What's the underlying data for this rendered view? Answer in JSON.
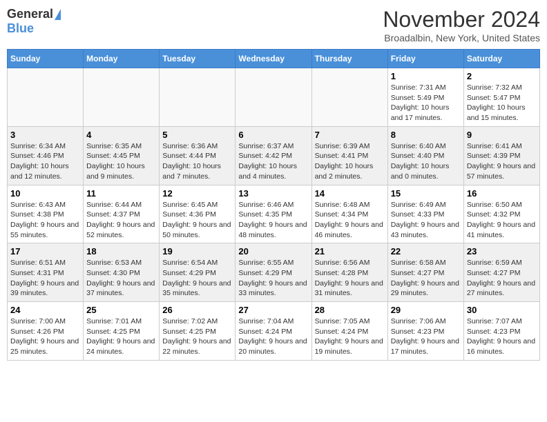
{
  "logo": {
    "general": "General",
    "blue": "Blue"
  },
  "title": "November 2024",
  "location": "Broadalbin, New York, United States",
  "headers": [
    "Sunday",
    "Monday",
    "Tuesday",
    "Wednesday",
    "Thursday",
    "Friday",
    "Saturday"
  ],
  "weeks": [
    [
      {
        "day": "",
        "info": ""
      },
      {
        "day": "",
        "info": ""
      },
      {
        "day": "",
        "info": ""
      },
      {
        "day": "",
        "info": ""
      },
      {
        "day": "",
        "info": ""
      },
      {
        "day": "1",
        "info": "Sunrise: 7:31 AM\nSunset: 5:49 PM\nDaylight: 10 hours and 17 minutes."
      },
      {
        "day": "2",
        "info": "Sunrise: 7:32 AM\nSunset: 5:47 PM\nDaylight: 10 hours and 15 minutes."
      }
    ],
    [
      {
        "day": "3",
        "info": "Sunrise: 6:34 AM\nSunset: 4:46 PM\nDaylight: 10 hours and 12 minutes."
      },
      {
        "day": "4",
        "info": "Sunrise: 6:35 AM\nSunset: 4:45 PM\nDaylight: 10 hours and 9 minutes."
      },
      {
        "day": "5",
        "info": "Sunrise: 6:36 AM\nSunset: 4:44 PM\nDaylight: 10 hours and 7 minutes."
      },
      {
        "day": "6",
        "info": "Sunrise: 6:37 AM\nSunset: 4:42 PM\nDaylight: 10 hours and 4 minutes."
      },
      {
        "day": "7",
        "info": "Sunrise: 6:39 AM\nSunset: 4:41 PM\nDaylight: 10 hours and 2 minutes."
      },
      {
        "day": "8",
        "info": "Sunrise: 6:40 AM\nSunset: 4:40 PM\nDaylight: 10 hours and 0 minutes."
      },
      {
        "day": "9",
        "info": "Sunrise: 6:41 AM\nSunset: 4:39 PM\nDaylight: 9 hours and 57 minutes."
      }
    ],
    [
      {
        "day": "10",
        "info": "Sunrise: 6:43 AM\nSunset: 4:38 PM\nDaylight: 9 hours and 55 minutes."
      },
      {
        "day": "11",
        "info": "Sunrise: 6:44 AM\nSunset: 4:37 PM\nDaylight: 9 hours and 52 minutes."
      },
      {
        "day": "12",
        "info": "Sunrise: 6:45 AM\nSunset: 4:36 PM\nDaylight: 9 hours and 50 minutes."
      },
      {
        "day": "13",
        "info": "Sunrise: 6:46 AM\nSunset: 4:35 PM\nDaylight: 9 hours and 48 minutes."
      },
      {
        "day": "14",
        "info": "Sunrise: 6:48 AM\nSunset: 4:34 PM\nDaylight: 9 hours and 46 minutes."
      },
      {
        "day": "15",
        "info": "Sunrise: 6:49 AM\nSunset: 4:33 PM\nDaylight: 9 hours and 43 minutes."
      },
      {
        "day": "16",
        "info": "Sunrise: 6:50 AM\nSunset: 4:32 PM\nDaylight: 9 hours and 41 minutes."
      }
    ],
    [
      {
        "day": "17",
        "info": "Sunrise: 6:51 AM\nSunset: 4:31 PM\nDaylight: 9 hours and 39 minutes."
      },
      {
        "day": "18",
        "info": "Sunrise: 6:53 AM\nSunset: 4:30 PM\nDaylight: 9 hours and 37 minutes."
      },
      {
        "day": "19",
        "info": "Sunrise: 6:54 AM\nSunset: 4:29 PM\nDaylight: 9 hours and 35 minutes."
      },
      {
        "day": "20",
        "info": "Sunrise: 6:55 AM\nSunset: 4:29 PM\nDaylight: 9 hours and 33 minutes."
      },
      {
        "day": "21",
        "info": "Sunrise: 6:56 AM\nSunset: 4:28 PM\nDaylight: 9 hours and 31 minutes."
      },
      {
        "day": "22",
        "info": "Sunrise: 6:58 AM\nSunset: 4:27 PM\nDaylight: 9 hours and 29 minutes."
      },
      {
        "day": "23",
        "info": "Sunrise: 6:59 AM\nSunset: 4:27 PM\nDaylight: 9 hours and 27 minutes."
      }
    ],
    [
      {
        "day": "24",
        "info": "Sunrise: 7:00 AM\nSunset: 4:26 PM\nDaylight: 9 hours and 25 minutes."
      },
      {
        "day": "25",
        "info": "Sunrise: 7:01 AM\nSunset: 4:25 PM\nDaylight: 9 hours and 24 minutes."
      },
      {
        "day": "26",
        "info": "Sunrise: 7:02 AM\nSunset: 4:25 PM\nDaylight: 9 hours and 22 minutes."
      },
      {
        "day": "27",
        "info": "Sunrise: 7:04 AM\nSunset: 4:24 PM\nDaylight: 9 hours and 20 minutes."
      },
      {
        "day": "28",
        "info": "Sunrise: 7:05 AM\nSunset: 4:24 PM\nDaylight: 9 hours and 19 minutes."
      },
      {
        "day": "29",
        "info": "Sunrise: 7:06 AM\nSunset: 4:23 PM\nDaylight: 9 hours and 17 minutes."
      },
      {
        "day": "30",
        "info": "Sunrise: 7:07 AM\nSunset: 4:23 PM\nDaylight: 9 hours and 16 minutes."
      }
    ]
  ],
  "row_styles": [
    "light",
    "gray",
    "light",
    "gray",
    "light"
  ]
}
